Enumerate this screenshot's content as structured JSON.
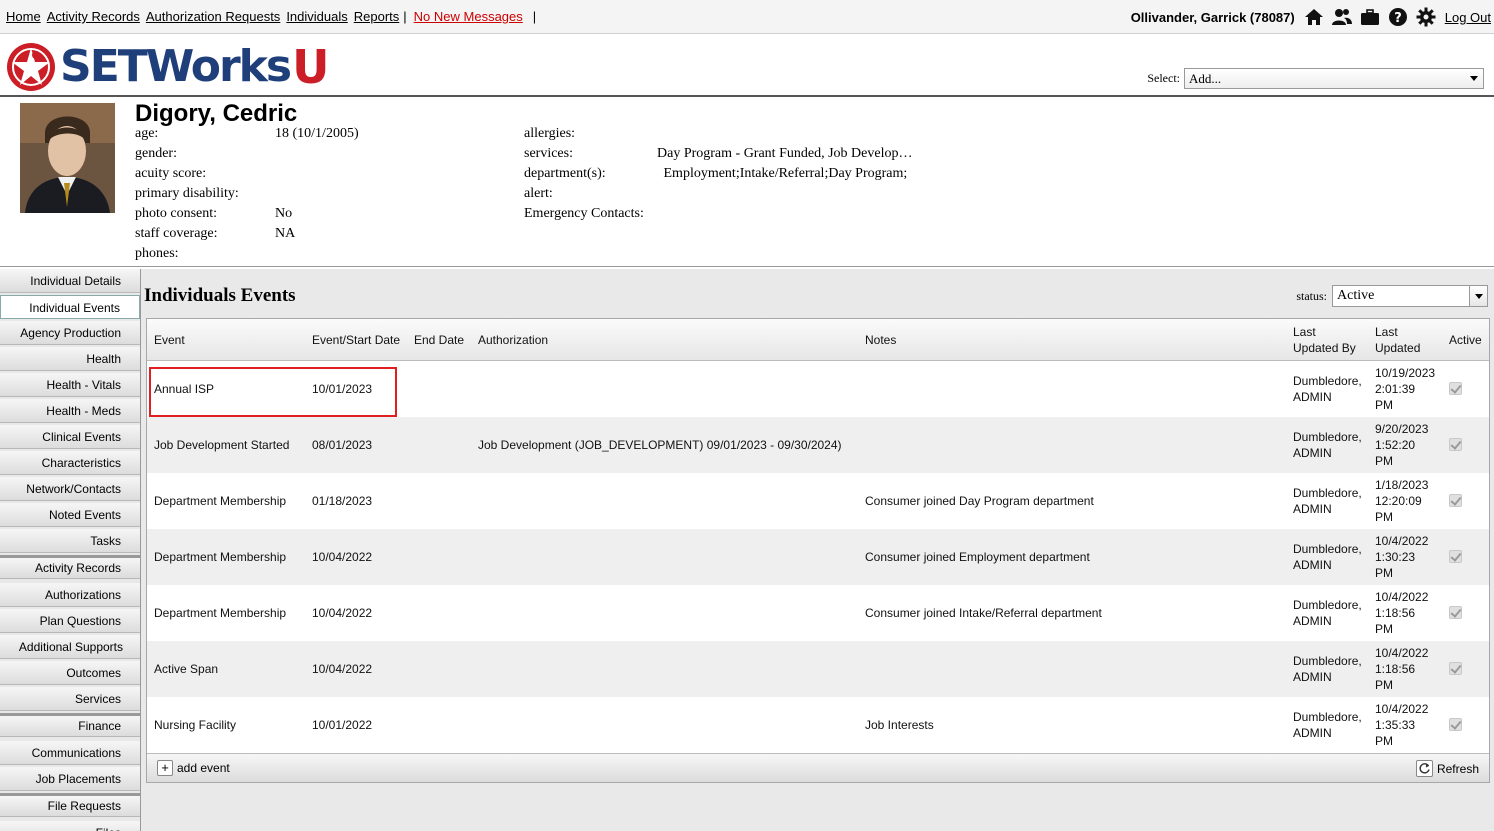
{
  "topnav": {
    "links": [
      "Home",
      "Activity Records",
      "Authorization Requests",
      "Individuals",
      "Reports"
    ],
    "separator": "|",
    "messages": "No New Messages",
    "user": "Ollivander, Garrick  (78087)",
    "logout": "Log Out",
    "icons": [
      "home-icon",
      "people-icon",
      "briefcase-icon",
      "help-icon",
      "gear-icon"
    ]
  },
  "brand": {
    "name": "SETWorks",
    "suffix": "U",
    "primary_color": "#1f3f7a",
    "accent_color": "#cc1e26"
  },
  "select": {
    "label": "Select:",
    "value": "Add..."
  },
  "profile": {
    "name": "Digory, Cedric",
    "left_fields": [
      {
        "label": "age:",
        "value": "18 (10/1/2005)"
      },
      {
        "label": "gender:",
        "value": ""
      },
      {
        "label": "acuity score:",
        "value": ""
      },
      {
        "label": "primary disability:",
        "value": ""
      },
      {
        "label": "photo consent:",
        "value": "No"
      },
      {
        "label": "staff coverage:",
        "value": "NA"
      },
      {
        "label": "phones:",
        "value": ""
      }
    ],
    "right_fields": [
      {
        "label": "allergies:",
        "value": ""
      },
      {
        "label": "services:",
        "value": "Day Program - Grant Funded, Job Develop…"
      },
      {
        "label": "department(s):",
        "value": " Employment;Intake/Referral;Day Program;"
      },
      {
        "label": "alert:",
        "value": ""
      },
      {
        "label": "Emergency Contacts:",
        "value": ""
      }
    ]
  },
  "sidebar": {
    "items": [
      {
        "label": "Individual Details"
      },
      {
        "label": "Individual Events",
        "selected": true
      },
      {
        "label": "Agency Production"
      },
      {
        "label": "Health"
      },
      {
        "label": "Health - Vitals"
      },
      {
        "label": "Health - Meds"
      },
      {
        "label": "Clinical Events"
      },
      {
        "label": "Characteristics"
      },
      {
        "label": "Network/Contacts"
      },
      {
        "label": "Noted Events"
      },
      {
        "label": "Tasks"
      },
      {
        "label": "Activity Records"
      },
      {
        "label": "Authorizations"
      },
      {
        "label": "Plan Questions"
      },
      {
        "label": "Additional Supports"
      },
      {
        "label": "Outcomes"
      },
      {
        "label": "Services"
      },
      {
        "label": "Finance"
      },
      {
        "label": "Communications"
      },
      {
        "label": "Job Placements"
      },
      {
        "label": "File Requests"
      },
      {
        "label": "Files"
      }
    ]
  },
  "main": {
    "title": "Individuals Events",
    "status_label": "status:",
    "status_value": "Active",
    "columns": [
      "Event",
      "Event/Start Date",
      "End Date",
      "Authorization",
      "Notes",
      "Last Updated By",
      "Last Updated",
      "Active"
    ],
    "rows": [
      {
        "event": "Annual ISP",
        "start": "10/01/2023",
        "end": "",
        "auth": "",
        "notes": "",
        "by1": "Dumbledore,",
        "by2": "ADMIN",
        "upd1": "10/19/2023",
        "upd2": "2:01:39",
        "upd3": "PM",
        "active": true
      },
      {
        "event": "Job Development Started",
        "start": "08/01/2023",
        "end": "",
        "auth": "Job Development (JOB_DEVELOPMENT) 09/01/2023 - 09/30/2024)",
        "notes": "",
        "by1": "Dumbledore,",
        "by2": "ADMIN",
        "upd1": "9/20/2023",
        "upd2": "1:52:20",
        "upd3": "PM",
        "active": true
      },
      {
        "event": "Department Membership",
        "start": "01/18/2023",
        "end": "",
        "auth": "",
        "notes": "Consumer joined Day Program department",
        "by1": "Dumbledore,",
        "by2": "ADMIN",
        "upd1": "1/18/2023",
        "upd2": "12:20:09",
        "upd3": "PM",
        "active": true
      },
      {
        "event": "Department Membership",
        "start": "10/04/2022",
        "end": "",
        "auth": "",
        "notes": "Consumer joined Employment department",
        "by1": "Dumbledore,",
        "by2": "ADMIN",
        "upd1": "10/4/2022",
        "upd2": "1:30:23",
        "upd3": "PM",
        "active": true
      },
      {
        "event": "Department Membership",
        "start": "10/04/2022",
        "end": "",
        "auth": "",
        "notes": "Consumer joined Intake/Referral department",
        "by1": "Dumbledore,",
        "by2": "ADMIN",
        "upd1": "10/4/2022",
        "upd2": "1:18:56",
        "upd3": "PM",
        "active": true
      },
      {
        "event": "Active Span",
        "start": "10/04/2022",
        "end": "",
        "auth": "",
        "notes": "",
        "by1": "Dumbledore,",
        "by2": "ADMIN",
        "upd1": "10/4/2022",
        "upd2": "1:18:56",
        "upd3": "PM",
        "active": true
      },
      {
        "event": "Nursing Facility",
        "start": "10/01/2022",
        "end": "",
        "auth": "",
        "notes": "Job Interests",
        "by1": "Dumbledore,",
        "by2": "ADMIN",
        "upd1": "10/4/2022",
        "upd2": "1:35:33",
        "upd3": "PM",
        "active": true
      }
    ],
    "add_event": "add event",
    "refresh": "Refresh"
  }
}
